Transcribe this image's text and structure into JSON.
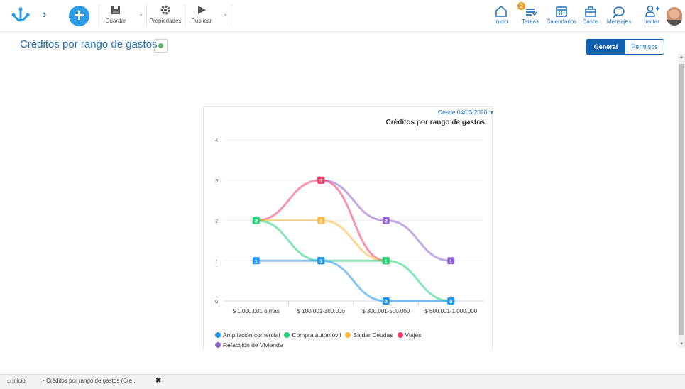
{
  "toolbar": {
    "save_label": "Guardar",
    "properties_label": "Propiedades",
    "publish_label": "Publicar"
  },
  "nav": {
    "items": [
      {
        "label": "Inicio",
        "icon": "home-icon"
      },
      {
        "label": "Tareas",
        "icon": "tasks-icon",
        "badge": "2"
      },
      {
        "label": "Calendarios",
        "icon": "calendar-icon"
      },
      {
        "label": "Casos",
        "icon": "briefcase-icon"
      },
      {
        "label": "Mensajes",
        "icon": "message-icon"
      },
      {
        "label": "Invitar",
        "icon": "invite-user-icon"
      }
    ]
  },
  "page": {
    "title": "Créditos por rango de gastos",
    "tabs": {
      "general": "General",
      "permissions": "Permisos"
    }
  },
  "chart_header": {
    "date_filter": "Desde 04/03/2020"
  },
  "chart_data": {
    "type": "line",
    "title": "Créditos por rango de gastos",
    "categories": [
      "$ 1.000.001 o más",
      "$ 100.001-300.000",
      "$ 300.001-500.000",
      "$ 500.001-1.000.000"
    ],
    "ylim": [
      0,
      4
    ],
    "yticks": [
      "0",
      "1",
      "2",
      "3",
      "4"
    ],
    "grid": true,
    "legend_position": "bottom-left",
    "series": [
      {
        "name": "Ampliación comercial",
        "color": "#2196f3",
        "values": [
          1,
          1,
          0,
          0
        ]
      },
      {
        "name": "Compra automóvil",
        "color": "#1ed279",
        "values": [
          2,
          1,
          1,
          0
        ]
      },
      {
        "name": "Saldar Deudas",
        "color": "#ffb53e",
        "values": [
          2,
          2,
          1,
          null
        ]
      },
      {
        "name": "Viajes",
        "color": "#f23c66",
        "values": [
          2,
          3,
          1,
          null
        ]
      },
      {
        "name": "Refacción de Vivienda",
        "color": "#8e63d4",
        "values": [
          null,
          3,
          2,
          1
        ]
      }
    ]
  },
  "bottom_tabs": {
    "home": "Inicio",
    "current": "Créditos por rango de gastos (Cre..."
  },
  "colors": {
    "accent": "#1f6fb8",
    "primary_button": "#2b9be8",
    "active_tab": "#0f5fae"
  }
}
